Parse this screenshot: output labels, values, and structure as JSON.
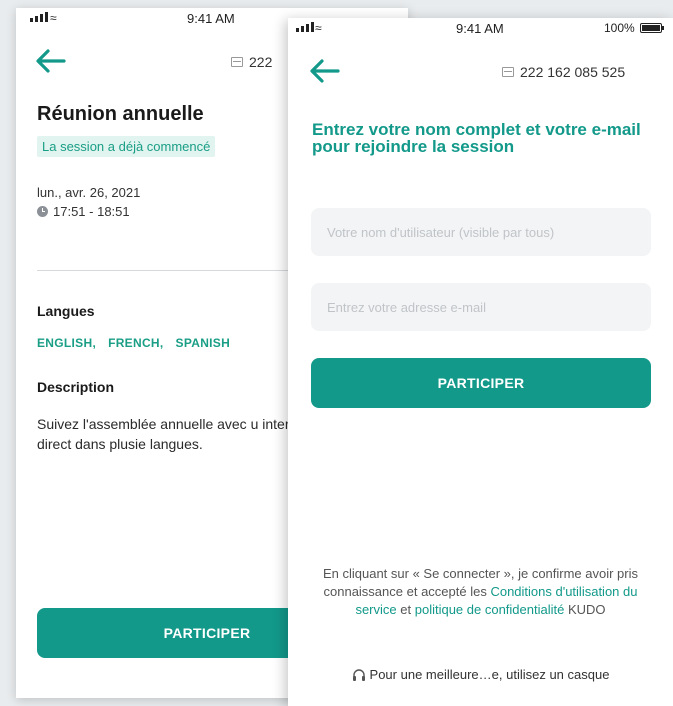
{
  "status_bar": {
    "time": "9:41 AM",
    "battery": "100%",
    "battery_level": 1.0
  },
  "meeting": {
    "id_back": "222",
    "id_front": "222 162 085 525"
  },
  "session": {
    "title": "Réunion annuelle",
    "status_badge": "La session a déjà commencé",
    "date": "lun., avr. 26, 2021",
    "time_range": "17:51 - 18:51"
  },
  "languages": {
    "heading": "Langues",
    "items": [
      "ENGLISH,",
      "FRENCH,",
      "SPANISH"
    ]
  },
  "description": {
    "heading": "Description",
    "text": "Suivez l'assemblée annuelle avec u interprétation en direct dans plusie langues."
  },
  "join_form": {
    "title": "Entrez votre nom complet et votre e-mail pour rejoindre la session",
    "name_placeholder": "Votre nom d'utilisateur (visible par tous)",
    "email_placeholder": "Entrez votre adresse e-mail",
    "participate_label": "PARTICIPER"
  },
  "back_participate_label": "PARTICIPER",
  "terms": {
    "prefix": "En cliquant sur « Se connecter », je confirme avoir pris connaissance et accepté les",
    "tos_link": "Conditions d'utilisation du service",
    "middle": "et",
    "privacy_link": "politique de confidentialité",
    "suffix": "KUDO"
  },
  "headset_tip": "Pour une meilleure…e, utilisez un casque",
  "colors": {
    "accent": "#12998a",
    "badge_bg": "#e1f4ef"
  },
  "icons": [
    "signal-icon",
    "wifi-icon",
    "battery-icon",
    "back-arrow-icon",
    "meeting-id-icon",
    "clock-icon",
    "headset-icon"
  ]
}
